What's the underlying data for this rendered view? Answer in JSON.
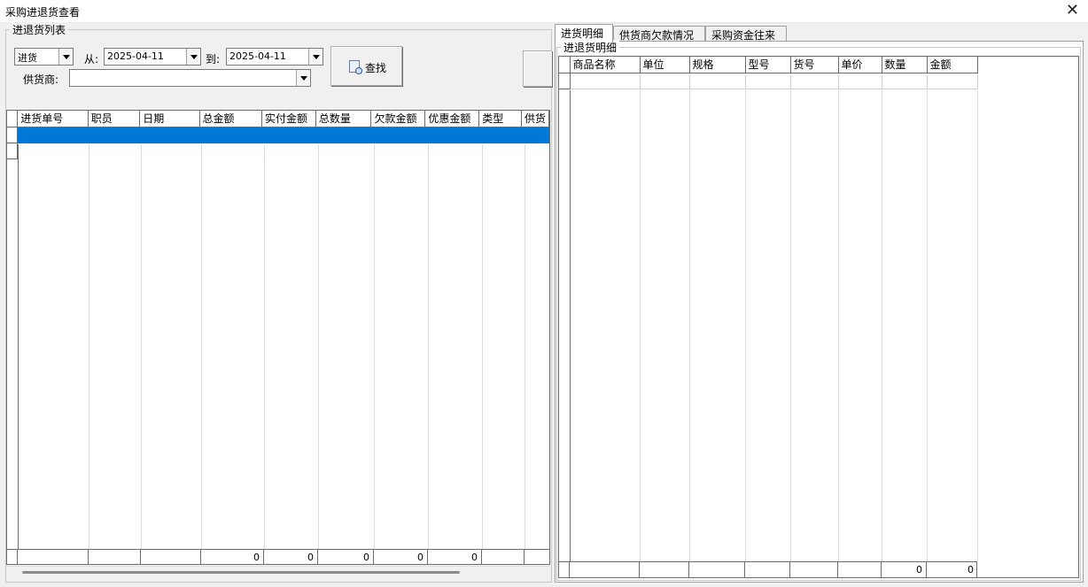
{
  "window": {
    "title": "采购进退货查看",
    "close_glyph": "✕"
  },
  "left": {
    "group_title": "进退货列表",
    "filter": {
      "type_value": "进货",
      "from_label": "从:",
      "from_date": "2025-04-11",
      "to_label": "到:",
      "to_date": "2025-04-11",
      "supplier_label": "供货商:",
      "supplier_value": "",
      "search_label": "查找"
    },
    "table": {
      "columns": [
        "进货单号",
        "职员",
        "日期",
        "总金额",
        "实付金额",
        "总数量",
        "欠款金额",
        "优惠金额",
        "类型",
        "供货"
      ],
      "footer": [
        "",
        "",
        "",
        "0",
        "0",
        "0",
        "0",
        "0",
        "",
        ""
      ]
    }
  },
  "right": {
    "tabs": [
      "进货明细",
      "供货商欠款情况",
      "采购资金往来"
    ],
    "group_title": "进退货明细",
    "table": {
      "columns": [
        "商品名称",
        "单位",
        "规格",
        "型号",
        "货号",
        "单价",
        "数量",
        "金额"
      ],
      "footer": [
        "",
        "",
        "",
        "",
        "",
        "",
        "0",
        "0"
      ]
    }
  }
}
